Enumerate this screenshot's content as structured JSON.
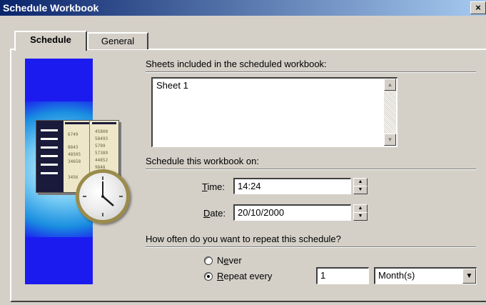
{
  "window": {
    "title": "Schedule Workbook",
    "close_glyph": "×"
  },
  "tabs": [
    {
      "label": "Schedule",
      "active": true
    },
    {
      "label": "General",
      "active": false
    }
  ],
  "sheets": {
    "label": "Sheets included in the scheduled workbook:",
    "items": [
      "Sheet 1"
    ]
  },
  "schedule": {
    "label": "Schedule this workbook on:",
    "time_label_accel": "T",
    "time_label_rest": "ime:",
    "time_value": "14:24",
    "date_label_accel": "D",
    "date_label_rest": "ate:",
    "date_value": "20/10/2000"
  },
  "repeat": {
    "question": "How often do you want to repeat this schedule?",
    "never_pre": "N",
    "never_accel": "e",
    "never_post": "ver",
    "never_selected": false,
    "every_accel": "R",
    "every_rest": "epeat every",
    "every_selected": true,
    "interval_value": "1",
    "unit_value": "Month(s)"
  },
  "illustration": {
    "numbers": [
      "6749",
      "45808",
      "58493",
      "8843",
      "5799",
      "48505",
      "57389",
      "34658",
      "44852",
      "9848",
      "3456"
    ]
  },
  "icons": {
    "scroll_up": "▲",
    "scroll_down": "▼",
    "dropdown": "▼"
  }
}
